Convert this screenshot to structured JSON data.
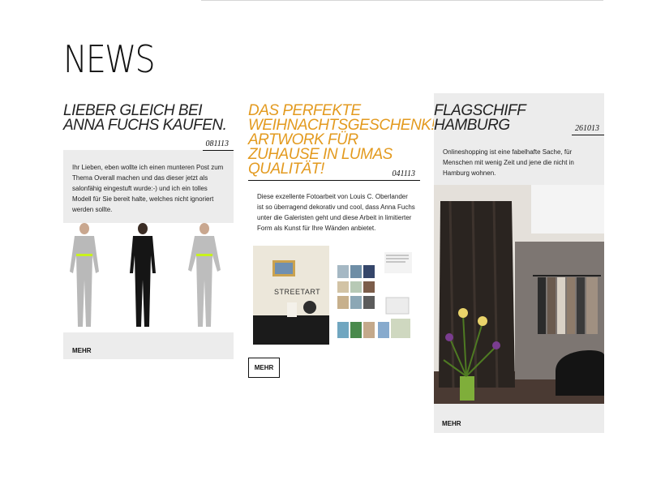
{
  "page": {
    "title": "NEWS"
  },
  "articles": [
    {
      "title": "LIEBER GLEICH BEI ANNA FUCHS KAUFEN.",
      "date": "081113",
      "excerpt": "Ihr Lieben, eben wollte ich einen munteren Post zum Thema Overall machen und das dieser jetzt als salonfähig eingestuft wurde:-) und ich ein tolles Modell für Sie bereit halte, welches nicht ignoriert werden sollte.",
      "more_label": "MEHR",
      "title_color": "#222222"
    },
    {
      "title": "DAS PERFEKTE WEIHNACHTSGESCHENK! ARTWORK FÜR ZUHAUSE IN LUMAS QUALITÄT!",
      "date": "041113",
      "excerpt": "Diese exzellente Fotoarbeit von Louis C. Oberlander ist so überragend dekorativ und cool, dass Anna Fuchs unter die Galeristen geht und diese Arbeit in limitierter Form als Kunst für Ihre Wänden anbietet.",
      "image_text": "STREETART",
      "more_label": "MEHR",
      "title_color": "#e39a1f"
    },
    {
      "title": "FLAGSCHIFF HAMBURG",
      "date": "261013",
      "excerpt": "Onlineshopping ist eine fabelhafte Sache, für Menschen mit wenig Zeit und jene die nicht in Hamburg wohnen.",
      "more_label": "MEHR",
      "title_color": "#222222"
    }
  ]
}
